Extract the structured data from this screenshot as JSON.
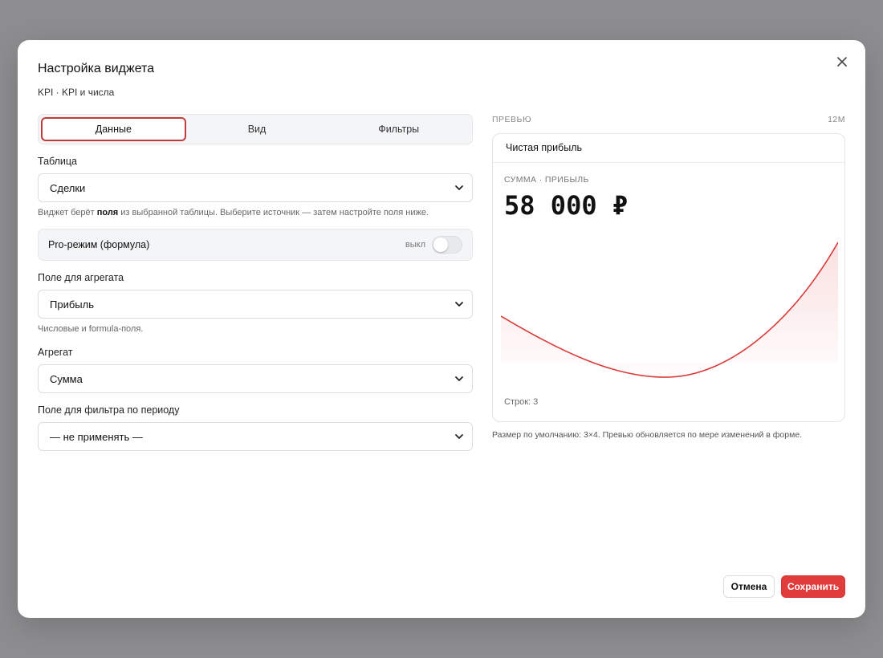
{
  "dialog": {
    "title": "Настройка виджета",
    "subtitle": "KPI · KPI и числа"
  },
  "tabs": [
    {
      "label": "Данные",
      "active": true
    },
    {
      "label": "Вид",
      "active": false
    },
    {
      "label": "Фильтры",
      "active": false
    }
  ],
  "form": {
    "table": {
      "label": "Таблица",
      "value": "Сделки"
    },
    "table_hint": {
      "prefix": "Виджет берёт ",
      "bold": "поля",
      "suffix": " из выбранной таблицы. Выберите источник — затем настройте поля ниже."
    },
    "pro_mode": {
      "label": "Pro-режим (формула)",
      "state": "выкл",
      "enabled": false
    },
    "agg_field": {
      "label": "Поле для агрегата",
      "value": "Прибыль",
      "hint": "Числовые и formula-поля."
    },
    "aggregate": {
      "label": "Агрегат",
      "value": "Сумма"
    },
    "period_field": {
      "label": "Поле для фильтра по периоду",
      "value": "— не применять —"
    }
  },
  "preview": {
    "heading": "ПРЕВЬЮ",
    "size": "12M",
    "card_title": "Чистая прибыль",
    "metric_label": "СУММА · ПРИБЫЛЬ",
    "metric_value": "58 000 ₽",
    "rows": "Строк: 3",
    "hint": "Размер по умолчанию: 3×4. Превью обновляется по мере изменений в форме.",
    "accent": "#e03c3c"
  },
  "buttons": {
    "cancel": "Отмена",
    "save": "Сохранить"
  },
  "colors": {
    "accent": "#e03c3c",
    "active_tab_border": "#c13c3c"
  }
}
